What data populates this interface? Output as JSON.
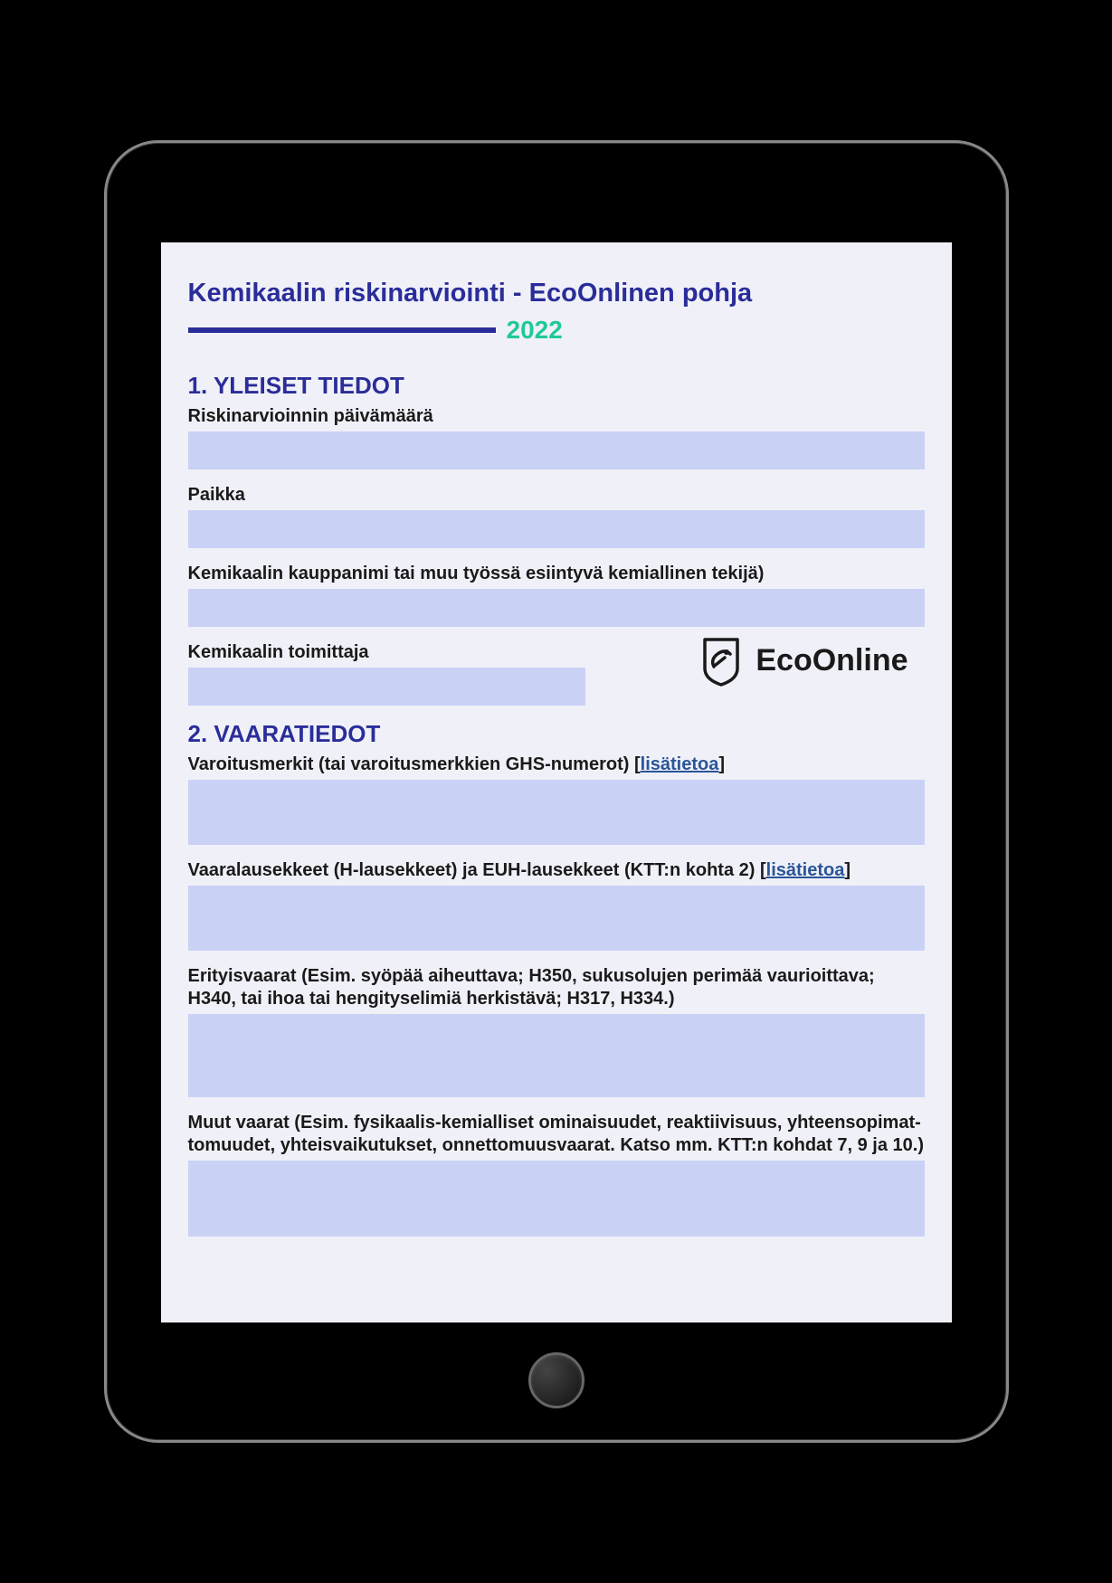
{
  "page": {
    "title": "Kemikaalin riskinarviointi - EcoOnlinen pohja",
    "year": "2022"
  },
  "logo": {
    "text": "EcoOnline"
  },
  "sections": {
    "general": {
      "heading": "1. YLEISET TIEDOT",
      "fields": {
        "date": {
          "label": "Riskinarvioinnin päivämäärä"
        },
        "location": {
          "label": "Paikka"
        },
        "chemical_name": {
          "label": "Kemikaalin kauppanimi tai muu työssä esiintyvä kemiallinen tekijä)"
        },
        "supplier": {
          "label": "Kemikaalin toimittaja"
        }
      }
    },
    "hazards": {
      "heading": "2. VAARATIEDOT",
      "fields": {
        "warning_signs": {
          "label_prefix": "Varoitusmerkit (tai varoitusmerkkien GHS-numerot) [",
          "link": "lisätietoa",
          "label_suffix": "]"
        },
        "hazard_statements": {
          "label_prefix": "Vaaralausekkeet (H-lausekkeet) ja EUH-lausekkeet (KTT:n kohta 2) [",
          "link": "lisätietoa",
          "label_suffix": "]"
        },
        "special_hazards": {
          "label": "Erityisvaarat (Esim. syöpää aiheuttava; H350, sukusolujen perimää vaurioittava; H340, tai ihoa tai hengityselimiä herkistävä; H317, H334.)"
        },
        "other_hazards": {
          "label": "Muut vaarat (Esim. fysikaalis-kemialliset ominaisuudet, reaktiivisuus, yhteensopimat-tomuudet, yhteisvaikutukset, onnettomuusvaarat. Katso mm. KTT:n kohdat 7, 9 ja 10.)"
        }
      }
    }
  }
}
